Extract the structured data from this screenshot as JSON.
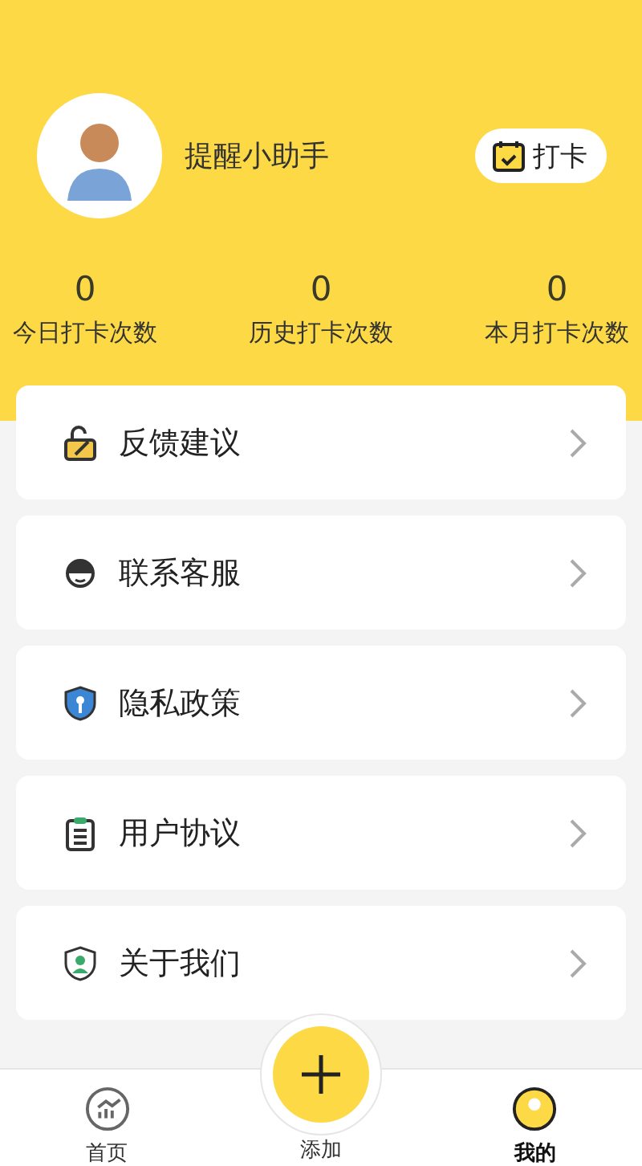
{
  "profile": {
    "name": "提醒小助手",
    "checkin_button": "打卡"
  },
  "stats": [
    {
      "value": "0",
      "label": "今日打卡次数"
    },
    {
      "value": "0",
      "label": "历史打卡次数"
    },
    {
      "value": "0",
      "label": "本月打卡次数"
    }
  ],
  "menu": [
    {
      "kind": "feedback",
      "label": "反馈建议"
    },
    {
      "kind": "service",
      "label": "联系客服"
    },
    {
      "kind": "privacy",
      "label": "隐私政策"
    },
    {
      "kind": "agreement",
      "label": "用户协议"
    },
    {
      "kind": "about",
      "label": "关于我们"
    }
  ],
  "tab_bar": [
    {
      "kind": "home",
      "label": "首页",
      "selected": false
    },
    {
      "kind": "add",
      "label": "添加",
      "selected": false
    },
    {
      "kind": "mine",
      "label": "我的",
      "selected": true
    }
  ]
}
